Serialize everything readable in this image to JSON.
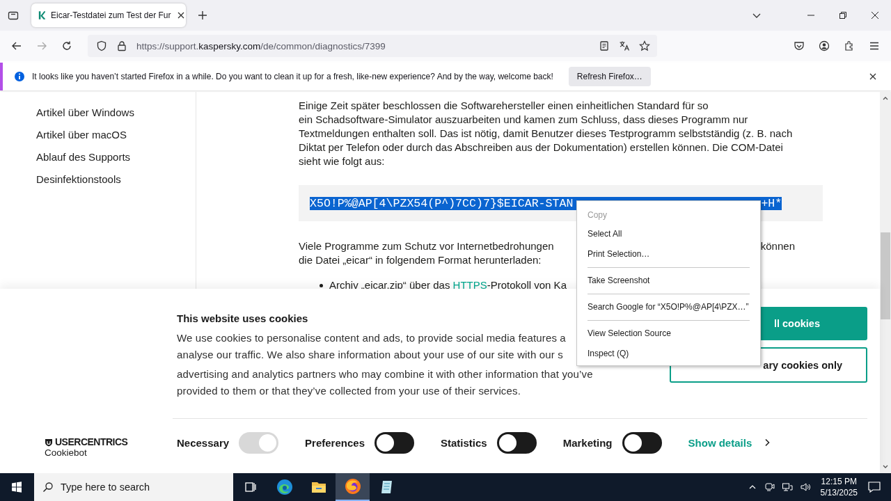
{
  "browser": {
    "tabs": [
      {
        "title": "Eicar-Testdatei zum Test der Fur",
        "selected": true
      }
    ],
    "url": {
      "scheme": "https://support.",
      "domain": "kaspersky.com",
      "path": "/de/common/diagnostics/7399"
    },
    "notification": {
      "message": "It looks like you haven’t started Firefox in a while. Do you want to clean it up for a fresh, like-new experience? And by the way, welcome back!",
      "button": "Refresh Firefox…"
    }
  },
  "sidebar": {
    "items": [
      "Artikel über Windows",
      "Artikel über macOS",
      "Ablauf des Supports",
      "Desinfektionstools"
    ]
  },
  "article": {
    "paragraph_1": [
      "Einige Zeit später beschlossen die Softwarehersteller einen einheitlichen Standard für so",
      "ein Schadsoftware-Simulator auszuarbeiten und kamen zum Schluss, dass dieses Programm nur",
      "Textmeldungen enthalten soll. Das ist nötig, damit Benutzer dieses Testprogramm selbstständig (z. B. nach",
      "Diktat per Telefon oder durch das Abschreiben aus der Dokumentation) erstellen können. Die COM-Datei",
      "sieht wie folgt aus:"
    ],
    "code_start": "X5O!P%@AP[4\\PZX54(P^)7CC)7}$EICAR-STAN",
    "code_end": "+H*",
    "paragraph_2_start": "Viele Programme zum Schutz vor Internetbedrohungen",
    "paragraph_2_end": "können",
    "paragraph_2_line_2": "die Datei „eicar“ in folgendem Format herunterladen:",
    "bullet": {
      "before": "Archiv „eicar.zip“ über das ",
      "link": "HTTPS",
      "after": "-Protokoll von Ka"
    }
  },
  "context_menu": {
    "items": [
      {
        "kind": "item",
        "label": "Copy",
        "disabled": true
      },
      {
        "kind": "item",
        "label": "Select All",
        "disabled": false
      },
      {
        "kind": "item",
        "label": "Print Selection…",
        "disabled": false
      },
      {
        "kind": "separator"
      },
      {
        "kind": "item",
        "label": "Take Screenshot",
        "disabled": false
      },
      {
        "kind": "separator"
      },
      {
        "kind": "item",
        "label": "Search Google for “X5O!P%@AP[4\\PZX…”",
        "disabled": false
      },
      {
        "kind": "separator"
      },
      {
        "kind": "item",
        "label": "View Selection Source",
        "disabled": false
      },
      {
        "kind": "item",
        "label": "Inspect (Q)",
        "disabled": false
      }
    ]
  },
  "cookie_banner": {
    "title": "This website uses cookies",
    "text": [
      [
        "We use cookies to personalise content and ads, to provide social media features a",
        "analyse our traffic. We also share information about your use of our site with our s"
      ],
      [
        "advertising and analytics partners who may combine it with other information that you’ve",
        "provided to them or that they’ve collected from your use of their services."
      ]
    ],
    "accept_button": "ll cookies",
    "deny_button": "ary cookies only",
    "logo": {
      "brand": "USERCENTRICS",
      "product": "Cookiebot"
    },
    "toggles": [
      {
        "label": "Necessary",
        "on": true,
        "disabled": true
      },
      {
        "label": "Preferences",
        "on": false,
        "disabled": false
      },
      {
        "label": "Statistics",
        "on": false,
        "disabled": false
      },
      {
        "label": "Marketing",
        "on": false,
        "disabled": false
      }
    ],
    "details_link": "Show details"
  },
  "taskbar": {
    "search_placeholder": "Type here to search",
    "apps": [
      {
        "kind": "task-view",
        "active": false
      },
      {
        "kind": "edge",
        "active": false
      },
      {
        "kind": "explorer",
        "active": false
      },
      {
        "kind": "firefox",
        "active": true
      },
      {
        "kind": "notepad",
        "active": false
      }
    ],
    "time": "12:15 PM",
    "date": "5/13/2025"
  }
}
